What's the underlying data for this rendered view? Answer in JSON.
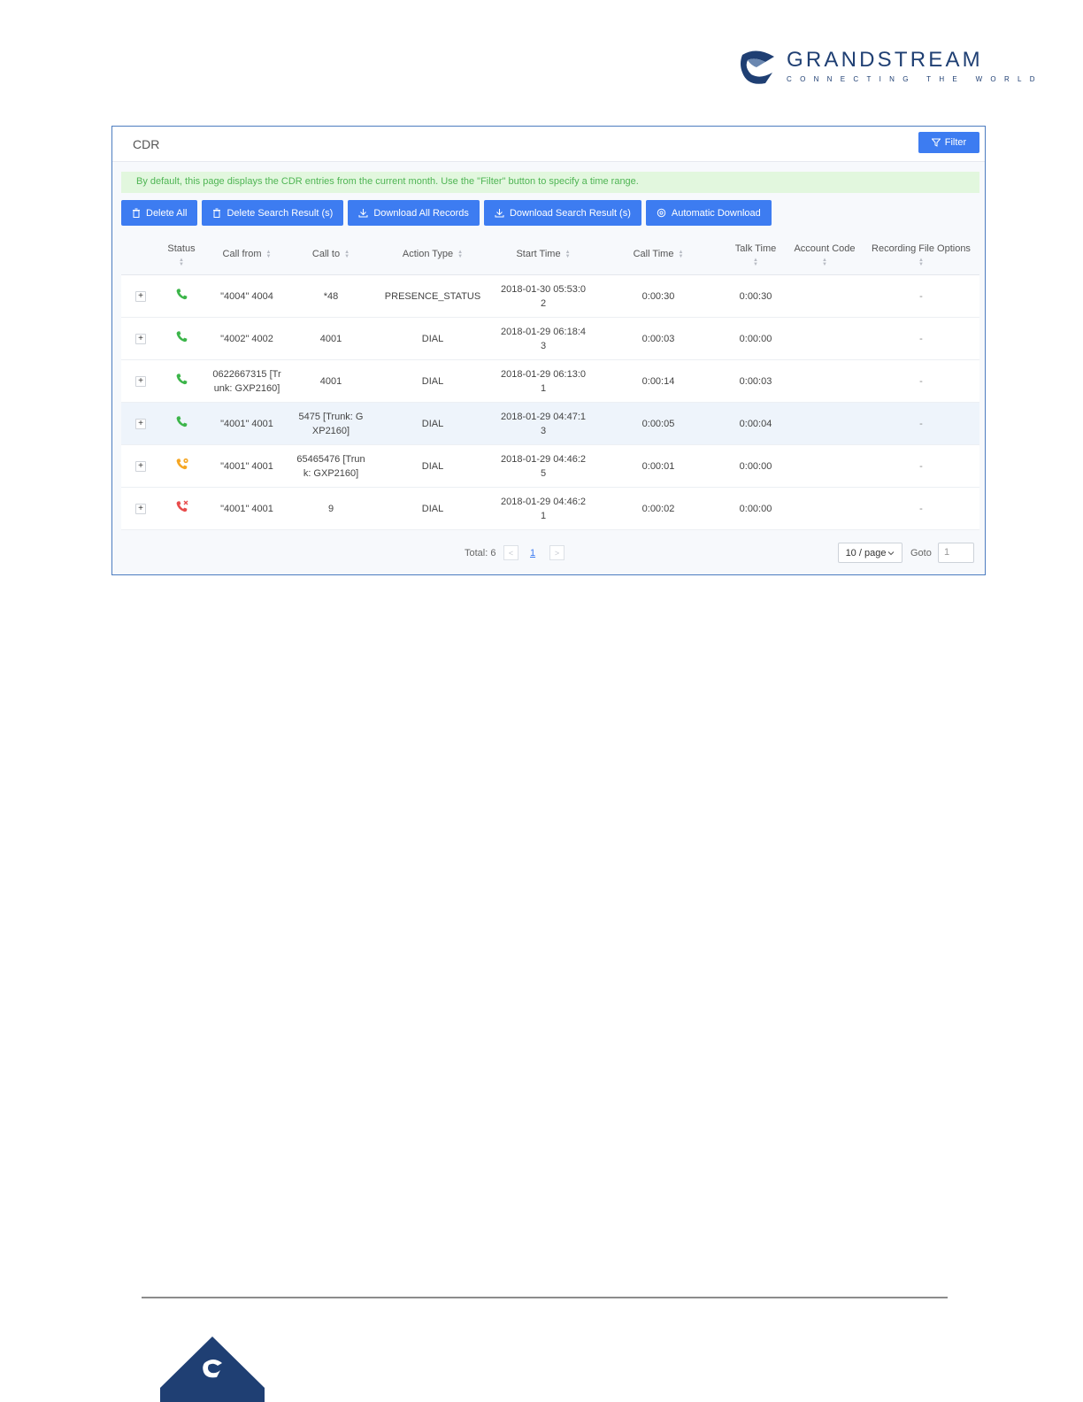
{
  "brand": {
    "name": "GRANDSTREAM",
    "tagline": "CONNECTING THE WORLD",
    "color": "#1f3f73"
  },
  "cdr": {
    "title": "CDR",
    "filter_label": "Filter",
    "notice": "By default, this page displays the CDR entries from the current month. Use the \"Filter\" button to specify a time range.",
    "toolbar": {
      "delete_all": "Delete All",
      "delete_search": "Delete Search Result (s)",
      "download_all": "Download All Records",
      "download_search": "Download Search Result (s)",
      "auto_download": "Automatic Download"
    },
    "columns": {
      "status": "Status",
      "call_from": "Call from",
      "call_to": "Call to",
      "action_type": "Action Type",
      "start_time": "Start Time",
      "call_time": "Call Time",
      "talk_time": "Talk Time",
      "account_code": "Account Code",
      "recording": "Recording File Options"
    },
    "rows": [
      {
        "expand": "+",
        "status": "answered",
        "call_from": "\"4004\" 4004",
        "call_to": "*48",
        "action_type": "PRESENCE_STATUS",
        "start_time": "2018-01-30 05:53:02",
        "call_time": "0:00:30",
        "talk_time": "0:00:30",
        "account_code": "",
        "recording": "-"
      },
      {
        "expand": "+",
        "status": "answered",
        "call_from": "\"4002\" 4002",
        "call_to": "4001",
        "action_type": "DIAL",
        "start_time": "2018-01-29 06:18:43",
        "call_time": "0:00:03",
        "talk_time": "0:00:00",
        "account_code": "",
        "recording": "-"
      },
      {
        "expand": "+",
        "status": "answered",
        "call_from": "0622667315 [Trunk: GXP2160]",
        "call_to": "4001",
        "action_type": "DIAL",
        "start_time": "2018-01-29 06:13:01",
        "call_time": "0:00:14",
        "talk_time": "0:00:03",
        "account_code": "",
        "recording": "-"
      },
      {
        "expand": "+",
        "status": "answered",
        "call_from": "\"4001\" 4001",
        "call_to": "5475 [Trunk: GXP2160]",
        "action_type": "DIAL",
        "start_time": "2018-01-29 04:47:13",
        "call_time": "0:00:05",
        "talk_time": "0:00:04",
        "account_code": "",
        "recording": "-"
      },
      {
        "expand": "+",
        "status": "busy",
        "call_from": "\"4001\" 4001",
        "call_to": "65465476 [Trunk: GXP2160]",
        "action_type": "DIAL",
        "start_time": "2018-01-29 04:46:25",
        "call_time": "0:00:01",
        "talk_time": "0:00:00",
        "account_code": "",
        "recording": "-"
      },
      {
        "expand": "+",
        "status": "failed",
        "call_from": "\"4001\" 4001",
        "call_to": "9",
        "action_type": "DIAL",
        "start_time": "2018-01-29 04:46:21",
        "call_time": "0:00:02",
        "talk_time": "0:00:00",
        "account_code": "",
        "recording": "-"
      }
    ],
    "pagination": {
      "total": "Total: 6",
      "prev": "<",
      "page": "1",
      "next": ">",
      "page_size": "10 / page",
      "goto_label": "Goto",
      "goto_value": "1"
    }
  },
  "colors": {
    "primary": "#3d7cf1",
    "answered": "#3cb54a",
    "busy": "#f5a623",
    "failed": "#e84c4c",
    "notice_bg": "#e2f7de",
    "notice_text": "#4fb554"
  }
}
